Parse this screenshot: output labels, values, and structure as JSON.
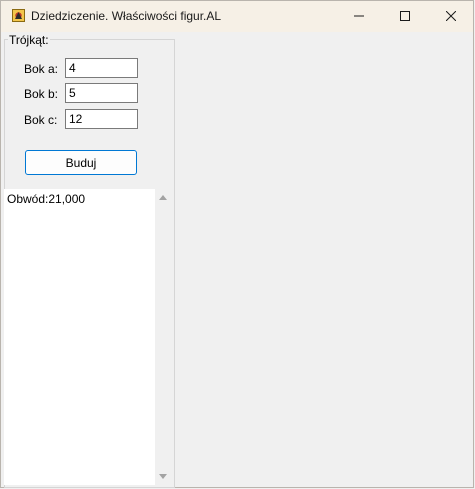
{
  "window": {
    "title": "Dziedziczenie. Właściwości figur.AL",
    "icon": "app-icon",
    "controls": [
      "minimize-icon",
      "maximize-icon",
      "close-icon"
    ]
  },
  "group": {
    "label": "Trójkąt:"
  },
  "fields": [
    {
      "label": "Bok a:",
      "value": "4"
    },
    {
      "label": "Bok b:",
      "value": "5"
    },
    {
      "label": "Bok c:",
      "value": "12"
    }
  ],
  "build_button": {
    "label": "Buduj",
    "accent": "#0078d4"
  },
  "output": {
    "text": "Obwód:21,000"
  }
}
